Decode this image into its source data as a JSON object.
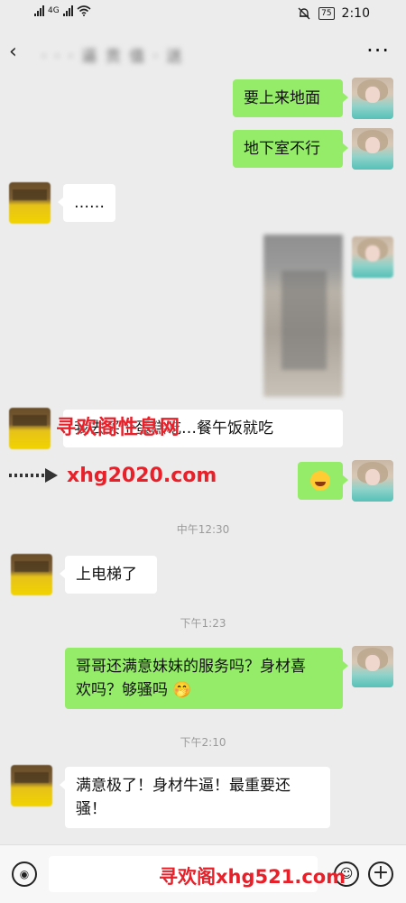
{
  "status_bar": {
    "network": "4G",
    "battery": "75",
    "time": "2:10"
  },
  "header": {
    "title_obscured": "· · · 逼 贡 值 · 送",
    "more": "···"
  },
  "messages": [
    {
      "side": "right",
      "type": "text",
      "text": "要上来地面"
    },
    {
      "side": "right",
      "type": "text",
      "text": "地下室不行"
    },
    {
      "side": "left",
      "type": "text",
      "text": "……"
    },
    {
      "side": "right",
      "type": "image"
    },
    {
      "side": "left",
      "type": "text",
      "text": "我去买个蛋糕吃…餐午饭就吃"
    },
    {
      "side": "right",
      "type": "emoji",
      "text": "😂"
    },
    {
      "type": "time",
      "text": "中午12:30"
    },
    {
      "side": "left",
      "type": "text",
      "text": "上电梯了"
    },
    {
      "type": "time",
      "text": "下午1:23"
    },
    {
      "side": "right",
      "type": "text",
      "line1": "哥哥还满意妹妹的服务吗？身材喜",
      "line2": "欢吗？够骚吗 🤭"
    },
    {
      "type": "time",
      "text": "下午2:10"
    },
    {
      "side": "left",
      "type": "text",
      "line1": "满意极了！身材牛逼！最重要还",
      "line2": "骚！"
    }
  ],
  "watermarks": {
    "top": "寻欢阁性息网",
    "url": "xhg2020.com",
    "bottom": "寻欢阁xhg521.com"
  },
  "input_bar": {
    "voice_icon": "voice-icon",
    "emoji_icon": "emoji-icon",
    "plus_icon": "plus-icon",
    "value": ""
  }
}
